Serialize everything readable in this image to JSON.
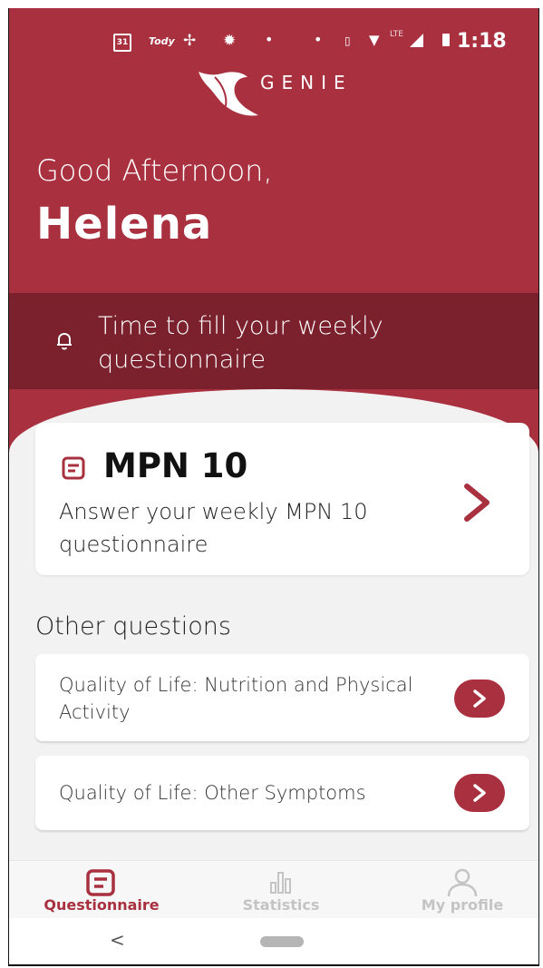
{
  "status_bar": {
    "calendar_day": "31",
    "app_badge": "Tody",
    "time": "1:18",
    "network": "LTE"
  },
  "logo": {
    "text": "GENIE"
  },
  "greeting": {
    "salutation": "Good Afternoon,",
    "name": "Helena"
  },
  "reminder": {
    "text": "Time to fill your weekly questionnaire"
  },
  "main_questionnaire": {
    "title": "MPN 10",
    "description": "Answer your weekly MPN 10 questionnaire"
  },
  "other_questions": {
    "title": "Other questions",
    "items": [
      {
        "label": "Quality of Life: Nutrition and Physical Activity"
      },
      {
        "label": "Quality of Life: Other Symptoms"
      }
    ]
  },
  "bottom_nav": {
    "items": [
      {
        "label": "Questionnaire",
        "icon": "questionnaire-icon",
        "active": true
      },
      {
        "label": "Statistics",
        "icon": "statistics-icon",
        "active": false
      },
      {
        "label": "My profile",
        "icon": "profile-icon",
        "active": false
      }
    ]
  },
  "system_nav": {
    "back_symbol": "<"
  },
  "colors": {
    "primary": "#a8303f",
    "primary_dark": "#7a212d",
    "background": "#f2f2f3",
    "inactive": "#c4c4c4"
  }
}
